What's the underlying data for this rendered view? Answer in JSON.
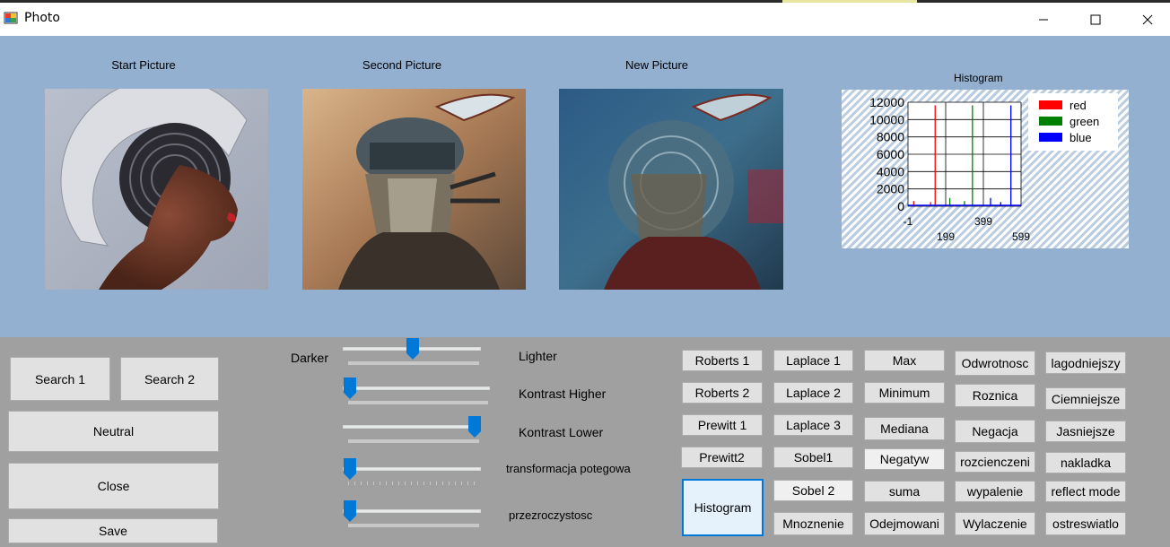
{
  "window": {
    "title": "Photo"
  },
  "pictures": {
    "start_label": "Start Picture",
    "second_label": "Second Picture",
    "new_label": "New Picture"
  },
  "histogram": {
    "title": "Histogram",
    "chart_data": {
      "type": "line",
      "title": "Histogram",
      "y_ticks": [
        "12000",
        "10000",
        "8000",
        "6000",
        "4000",
        "2000",
        "0"
      ],
      "x_ticks_top": [
        "-1",
        "399"
      ],
      "x_ticks_bottom": [
        "199",
        "599"
      ],
      "ylim": [
        0,
        12000
      ],
      "series": [
        {
          "name": "red",
          "color": "#ff0000"
        },
        {
          "name": "green",
          "color": "#008000"
        },
        {
          "name": "blue",
          "color": "#0000ff"
        }
      ]
    }
  },
  "left_buttons": {
    "search1": "Search 1",
    "search2": "Search 2",
    "neutral": "Neutral",
    "close": "Close",
    "save": "Save"
  },
  "sliders": {
    "darker": "Darker",
    "lighter": "Lighter",
    "kontrast_higher": "Kontrast Higher",
    "kontrast_lower": "Kontrast Lower",
    "transformacja": "transformacja potegowa",
    "przezroczystosc": "przezroczystosc",
    "brightness_value": 0.5,
    "kontrast_higher_value": 0.0,
    "kontrast_lower_value": 1.0,
    "transformacja_value": 0.0,
    "przezroczystosc_value": 0.0
  },
  "filters": {
    "col1": [
      "Roberts 1",
      "Roberts 2",
      "Prewitt 1",
      "Prewitt2",
      "Histogram"
    ],
    "col2": [
      "Laplace 1",
      "Laplace 2",
      "Laplace 3",
      "Sobel1",
      "Sobel 2",
      "Mnoznenie"
    ],
    "col3": [
      "Max",
      "Minimum",
      "Mediana",
      "Negatyw",
      "suma",
      "Odejmowani"
    ],
    "col4": [
      "Odwrotnosc",
      "Roznica",
      "Negacja",
      "rozcienczeni",
      "wypalenie",
      "Wylaczenie"
    ],
    "col5": [
      "lagodniejszy",
      "Ciemniejsze",
      "Jasniejsze",
      "nakladka",
      "reflect mode",
      "ostreswiatlo"
    ]
  },
  "colors": {
    "accent": "#0078d7",
    "top_panel": "#93b0d0",
    "bottom_panel": "#a0a0a0"
  }
}
